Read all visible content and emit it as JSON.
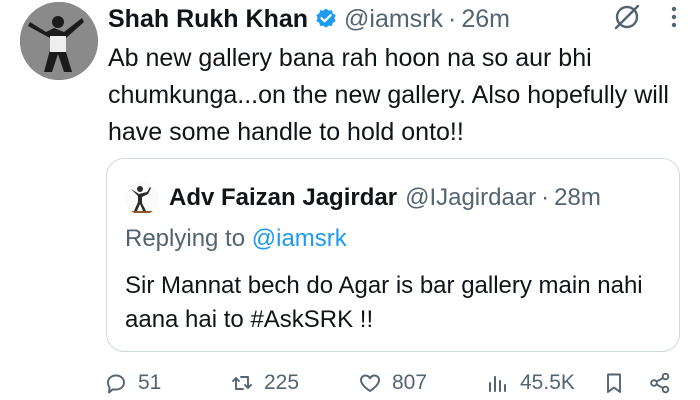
{
  "tweet": {
    "author_name": "Shah Rukh Khan",
    "handle": "@iamsrk",
    "separator": "·",
    "time": "26m",
    "text": "Ab new gallery bana rah hoon na so aur bhi chumkunga...on the new gallery. Also hopefully will have some handle to hold onto!!"
  },
  "quote": {
    "author_name": "Adv Faizan Jagirdar",
    "handle": "@IJagirdaar",
    "separator": "·",
    "time": "28m",
    "replying_prefix": "Replying to ",
    "replying_to": "@iamsrk",
    "text": "Sir Mannat bech do Agar is bar gallery main nahi aana hai to #AskSRK !!"
  },
  "actions": {
    "replies": "51",
    "reposts": "225",
    "likes": "807",
    "views": "45.5K"
  },
  "colors": {
    "text": "#0f1419",
    "secondary": "#536471",
    "accent": "#1d9bf0",
    "border": "#cfd9de"
  },
  "icons": [
    "verified-badge-icon",
    "grok-icon",
    "more-icon",
    "reply-icon",
    "repost-icon",
    "like-icon",
    "views-icon",
    "bookmark-icon",
    "share-icon"
  ]
}
